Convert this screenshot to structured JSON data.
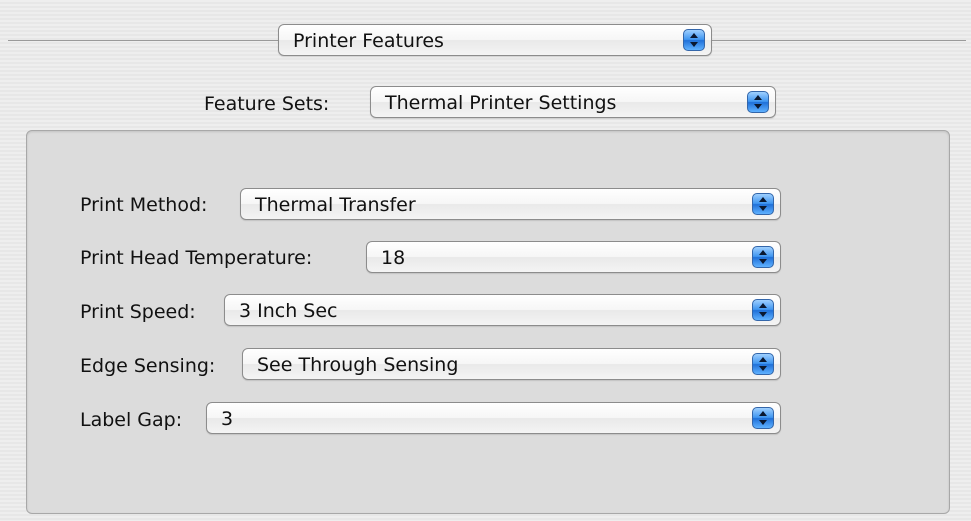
{
  "header": {
    "pane_select_value": "Printer Features"
  },
  "feature_sets": {
    "label": "Feature Sets:",
    "value": "Thermal Printer Settings"
  },
  "settings": [
    {
      "label": "Print Method:",
      "value": "Thermal Transfer"
    },
    {
      "label": "Print Head Temperature:",
      "value": "18"
    },
    {
      "label": "Print Speed:",
      "value": "3 Inch Sec"
    },
    {
      "label": "Edge Sensing:",
      "value": "See Through Sensing"
    },
    {
      "label": "Label Gap:",
      "value": "3"
    }
  ],
  "colors": {
    "window_bg": "#ececec",
    "group_bg": "#dcdcdc",
    "popup_arrow_accent": "#3e95f0"
  },
  "icons": {
    "popup_arrows": "up-down-chevron-icon"
  }
}
